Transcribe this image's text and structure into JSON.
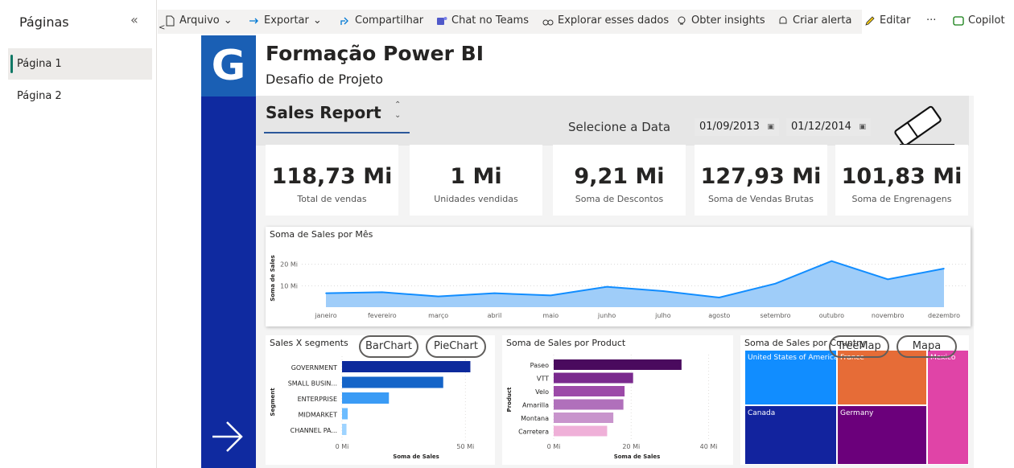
{
  "pages_pane": {
    "title": "Páginas",
    "collapse_icon": "«",
    "pages": [
      "Página 1",
      "Página 2"
    ],
    "active_page": "Página 1"
  },
  "toolbar": {
    "items": [
      "Arquivo",
      "Exportar",
      "Compartilhar",
      "Chat no Teams",
      "Explorar esses dados",
      "Obter insights",
      "Criar alerta",
      "Editar",
      "···",
      "Copilot"
    ]
  },
  "report": {
    "logo_letter": "G",
    "title": "Formação Power BI",
    "subtitle": "Desafio de Projeto",
    "section_title": "Sales Report",
    "date_label": "Selecione a Data",
    "date_start": "01/09/2013",
    "date_end": "01/12/2014",
    "kpis": [
      {
        "value": "118,73 Mi",
        "label": "Total de vendas"
      },
      {
        "value": "1 Mi",
        "label": "Unidades vendidas"
      },
      {
        "value": "9,21 Mi",
        "label": "Soma de Descontos"
      },
      {
        "value": "127,93 Mi",
        "label": "Soma de Vendas Brutas"
      },
      {
        "value": "101,83 Mi",
        "label": "Soma de Engrenagens"
      }
    ],
    "buttons": {
      "barchart": "BarChart",
      "piechart": "PieChart",
      "treemap": "TreeMap",
      "mapa": "Mapa"
    },
    "colors": {
      "left_band": "#0f2aa0",
      "area_line": "#118dff",
      "area_fill": "#9fcdf9"
    }
  },
  "chart_data": [
    {
      "type": "area",
      "title": "Soma de Sales por Mês",
      "ylabel": "Soma de Sales",
      "xlabel": "",
      "categories": [
        "janeiro",
        "fevereiro",
        "março",
        "abril",
        "maio",
        "junho",
        "julho",
        "agosto",
        "setembro",
        "outubro",
        "novembro",
        "dezembro"
      ],
      "values": [
        6.5,
        7.0,
        5.0,
        6.5,
        5.5,
        9.5,
        7.5,
        4.5,
        11.0,
        21.5,
        13.0,
        18.0
      ],
      "y_ticks": [
        "10 Mi",
        "20 Mi"
      ],
      "ylim": [
        0,
        27
      ],
      "grid": true
    },
    {
      "type": "bar",
      "orientation": "horizontal",
      "title": "Sales X segments",
      "xlabel": "Soma de Sales",
      "ylabel": "Segment",
      "categories": [
        "GOVERNMENT",
        "SMALL BUSIN...",
        "ENTERPRISE",
        "MIDMARKET",
        "CHANNEL PA..."
      ],
      "values": [
        52,
        41,
        19,
        2.3,
        1.8
      ],
      "colors": [
        "#0d2a9c",
        "#1464c8",
        "#3a9bf5",
        "#6cbcff",
        "#9ed3ff"
      ],
      "x_ticks": [
        "0 Mi",
        "50 Mi"
      ],
      "xlim": [
        0,
        60
      ]
    },
    {
      "type": "bar",
      "orientation": "horizontal",
      "title": "Soma de Sales por Product",
      "xlabel": "Soma de Sales",
      "ylabel": "Product",
      "categories": [
        "Paseo",
        "VTT",
        "Velo",
        "Amarilla",
        "Montana",
        "Carretera"
      ],
      "values": [
        33.0,
        20.5,
        18.3,
        18.0,
        15.4,
        13.8
      ],
      "colors": [
        "#4a0a5e",
        "#7a2a8e",
        "#9c4aa8",
        "#b070bb",
        "#c894cc",
        "#efb0d8"
      ],
      "x_ticks": [
        "0 Mi",
        "20 Mi",
        "40 Mi"
      ],
      "xlim": [
        0,
        43
      ]
    },
    {
      "type": "treemap",
      "title": "Soma de Sales por Country",
      "categories": [
        "United States of America",
        "France",
        "Canada",
        "Germany",
        "Mexico"
      ],
      "colors": [
        "#118dff",
        "#e66c37",
        "#12239e",
        "#6b007b",
        "#e044a7"
      ]
    }
  ]
}
